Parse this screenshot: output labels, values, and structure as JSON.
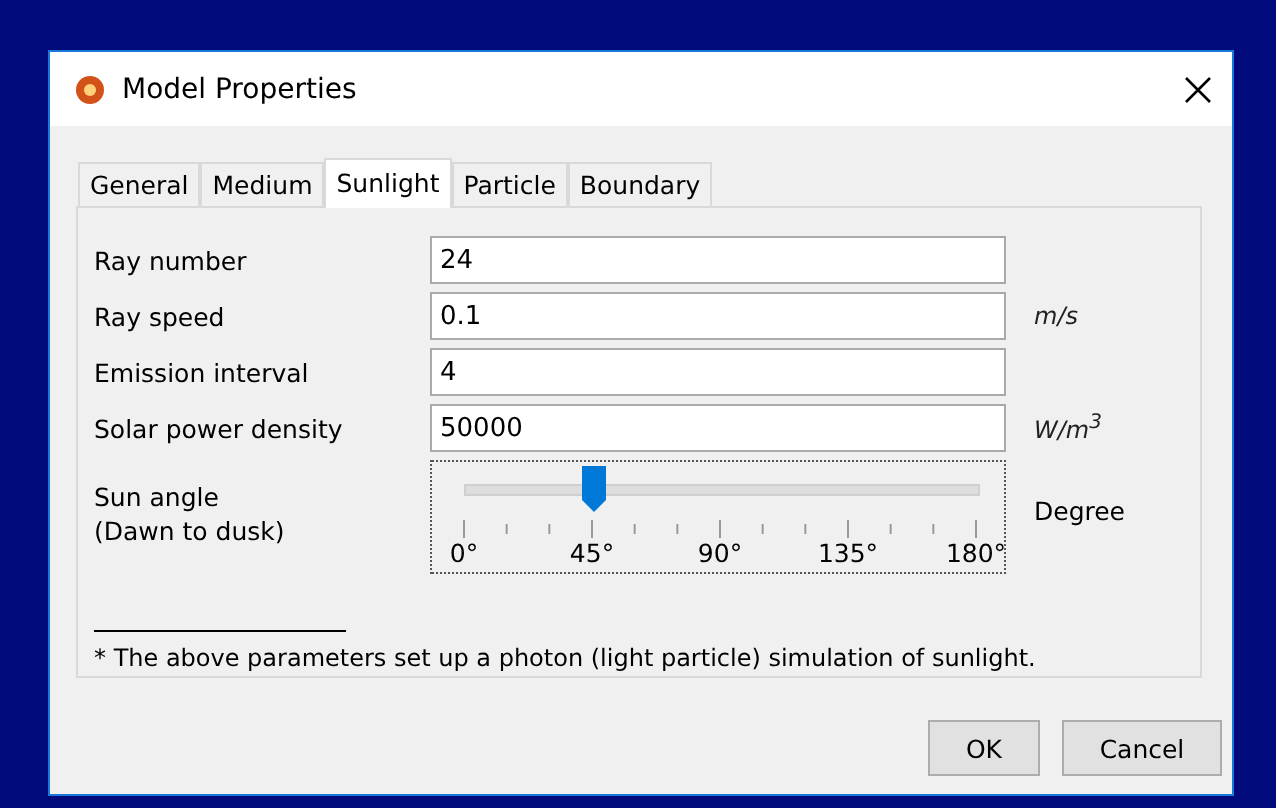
{
  "window": {
    "title": "Model Properties"
  },
  "tabs": [
    {
      "label": "General",
      "selected": false
    },
    {
      "label": "Medium",
      "selected": false
    },
    {
      "label": "Sunlight",
      "selected": true
    },
    {
      "label": "Particle",
      "selected": false
    },
    {
      "label": "Boundary",
      "selected": false
    }
  ],
  "fields": [
    {
      "label": "Ray number",
      "value": "24"
    },
    {
      "label": "Ray speed",
      "value": "0.1",
      "unit": "m/s"
    },
    {
      "label": "Emission interval",
      "value": "4"
    },
    {
      "label": "Solar power density",
      "value": "50000",
      "unit": "W/m$^{3}$"
    }
  ],
  "sun_angle": {
    "label_lines": [
      "Sun angle",
      "(Dawn to dusk)"
    ],
    "level": 0.25,
    "tick_labels": [
      "0°",
      "45°",
      "90°",
      "135°",
      "180°"
    ],
    "unit": "Degree"
  },
  "footnote": "* The above parameters set up a photon (light particle) simulation of sunlight.",
  "buttons": [
    "OK",
    "Cancel"
  ]
}
